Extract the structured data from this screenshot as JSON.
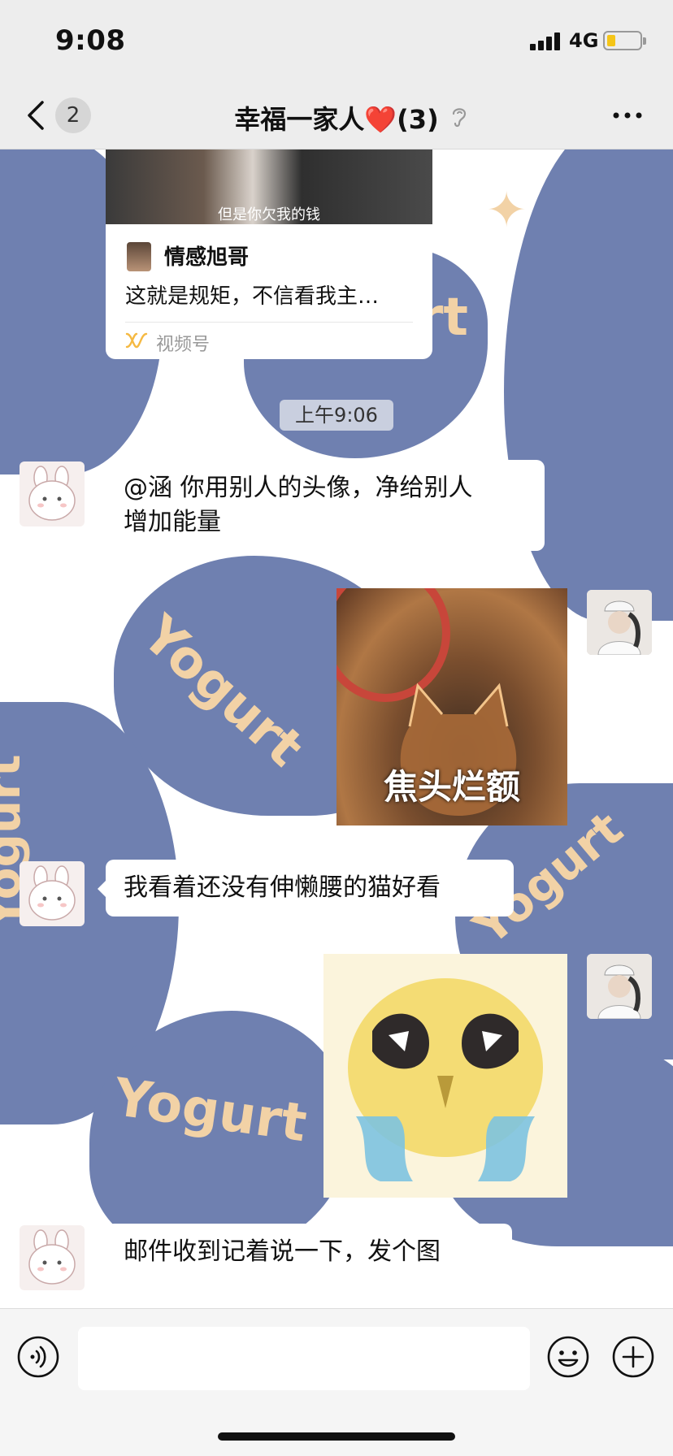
{
  "status_bar": {
    "time": "9:08",
    "network": "4G"
  },
  "nav": {
    "unread_count": "2",
    "title": "幸福一家人",
    "heart": "❤️",
    "member_count": "(3)",
    "icons": [
      "back-chevron-icon",
      "ear-icon",
      "more-dots-icon"
    ]
  },
  "video_card": {
    "subtitle": "但是你欠我的钱",
    "author": "情感旭哥",
    "description": "这就是规矩，不信看我主…",
    "source": "视频号"
  },
  "timestamp": "上午9:06",
  "messages": [
    {
      "side": "left",
      "type": "text",
      "lines": [
        "@涵 你用别人的头像，净给别人",
        "增加能量"
      ]
    },
    {
      "side": "right",
      "type": "image",
      "caption": "焦头烂额"
    },
    {
      "side": "left",
      "type": "text",
      "lines": [
        "我看着还没有伸懒腰的猫好看"
      ]
    },
    {
      "side": "right",
      "type": "image",
      "caption": ""
    },
    {
      "side": "left",
      "type": "text",
      "lines": [
        "邮件收到记着说一下，发个图"
      ]
    }
  ],
  "background": {
    "watermark_text": "Yogurt",
    "blob_color": "#6f80b0",
    "text_color": "#f2d2a6"
  },
  "input_bar": {
    "icons": [
      "voice-icon",
      "emoji-icon",
      "plus-icon"
    ]
  }
}
